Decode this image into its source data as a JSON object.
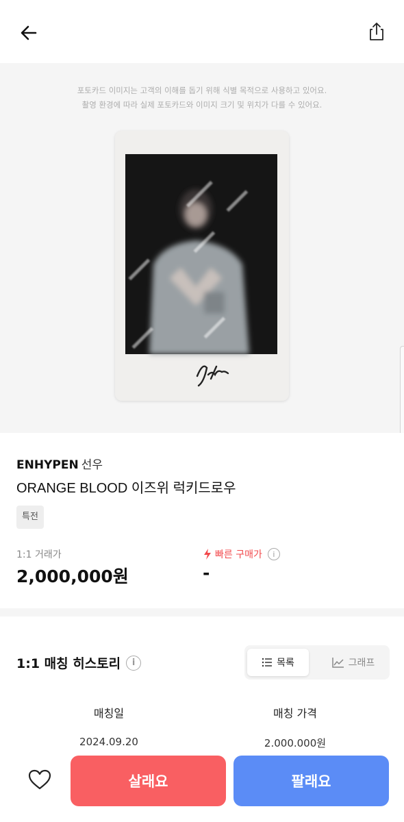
{
  "header": {
    "back_icon": "arrow-left-icon",
    "share_icon": "share-icon"
  },
  "notice": {
    "line1": "포토카드 이미지는 고객의 이해를 돕기 위해 식별 목적으로 사용하고 있어요.",
    "line2": "촬영 환경에 따라 실제 포토카드와 이미지 크기 및 위치가 다를 수 있어요."
  },
  "product": {
    "group": "ENHYPEN",
    "member": "선우",
    "name": "ORANGE BLOOD 이즈위 럭키드로우",
    "tag": "특전"
  },
  "prices": {
    "trade_label": "1:1 거래가",
    "trade_value": "2,000,000원",
    "fast_label": "빠른 구매가",
    "fast_value": "-",
    "fast_color": "#f2484b"
  },
  "history": {
    "title": "1:1 매칭 히스토리",
    "toggle_list": "목록",
    "toggle_graph": "그래프",
    "columns": [
      "매칭일",
      "매칭 가격"
    ],
    "rows": [
      [
        "2024.09.20",
        "2.000.000원"
      ]
    ]
  },
  "actions": {
    "buy": "살래요",
    "sell": "팔래요",
    "buy_color": "#f95f62",
    "sell_color": "#5b8cf6",
    "like_icon": "heart-icon"
  }
}
